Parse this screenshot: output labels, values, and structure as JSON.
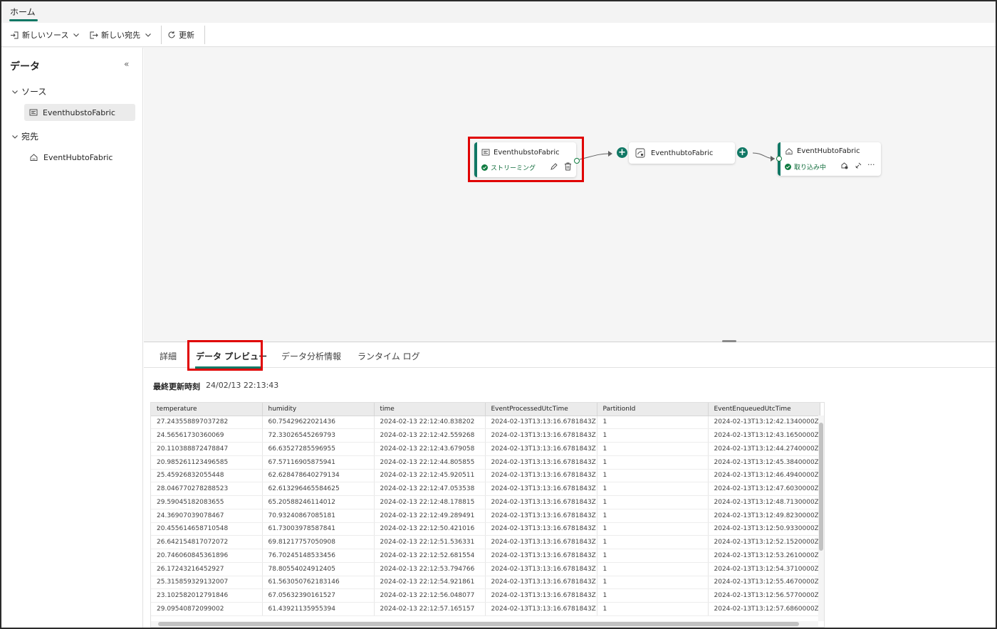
{
  "ribbon": {
    "home_tab": "ホーム"
  },
  "toolbar": {
    "new_source": "新しいソース",
    "new_destination": "新しい宛先",
    "refresh": "更新"
  },
  "sidebar": {
    "title": "データ",
    "groups": [
      {
        "label": "ソース",
        "items": [
          "EventhubstoFabric"
        ]
      },
      {
        "label": "宛先",
        "items": [
          "EventHubtoFabric"
        ]
      }
    ]
  },
  "canvas": {
    "source_node": {
      "title": "EventhubstoFabric",
      "status": "ストリーミング"
    },
    "stream_node": {
      "title": "EventhubtoFabric"
    },
    "dest_node": {
      "title": "EventHubtoFabric",
      "status": "取り込み中"
    }
  },
  "bottom_tabs": [
    "詳細",
    "データ プレビュー",
    "データ分析情報",
    "ランタイム ログ"
  ],
  "active_tab": "データ プレビュー",
  "last_updated": {
    "label": "最終更新時刻",
    "value": "24/02/13 22:13:43"
  },
  "table": {
    "columns": [
      "temperature",
      "humidity",
      "time",
      "EventProcessedUtcTime",
      "PartitionId",
      "EventEnqueuedUtcTime"
    ],
    "rows": [
      [
        "27.243558897037282",
        "60.75429622021436",
        "2024-02-13 22:12:40.838202",
        "2024-02-13T13:13:16.6781843Z",
        "1",
        "2024-02-13T13:12:42.1340000Z"
      ],
      [
        "24.56561730360069",
        "72.33026545269793",
        "2024-02-13 22:12:42.559268",
        "2024-02-13T13:13:16.6781843Z",
        "1",
        "2024-02-13T13:12:43.1650000Z"
      ],
      [
        "20.110388872478847",
        "66.63527285596955",
        "2024-02-13 22:12:43.679058",
        "2024-02-13T13:13:16.6781843Z",
        "1",
        "2024-02-13T13:12:44.2740000Z"
      ],
      [
        "20.985261123496585",
        "67.57116905875941",
        "2024-02-13 22:12:44.805855",
        "2024-02-13T13:13:16.6781843Z",
        "1",
        "2024-02-13T13:12:45.3840000Z"
      ],
      [
        "25.45926832055448",
        "62.628478640279134",
        "2024-02-13 22:12:45.920511",
        "2024-02-13T13:13:16.6781843Z",
        "1",
        "2024-02-13T13:12:46.4940000Z"
      ],
      [
        "28.046770278288523",
        "62.613296465584625",
        "2024-02-13 22:12:47.053538",
        "2024-02-13T13:13:16.6781843Z",
        "1",
        "2024-02-13T13:12:47.6030000Z"
      ],
      [
        "29.59045182083655",
        "65.20588246114012",
        "2024-02-13 22:12:48.178815",
        "2024-02-13T13:13:16.6781843Z",
        "1",
        "2024-02-13T13:12:48.7130000Z"
      ],
      [
        "24.36907039078467",
        "70.93240867085181",
        "2024-02-13 22:12:49.289491",
        "2024-02-13T13:13:16.6781843Z",
        "1",
        "2024-02-13T13:12:49.8230000Z"
      ],
      [
        "20.455614658710548",
        "61.73003978587841",
        "2024-02-13 22:12:50.421016",
        "2024-02-13T13:13:16.6781843Z",
        "1",
        "2024-02-13T13:12:50.9330000Z"
      ],
      [
        "26.642154817072072",
        "69.81217757050908",
        "2024-02-13 22:12:51.536331",
        "2024-02-13T13:13:16.6781843Z",
        "1",
        "2024-02-13T13:12:52.1520000Z"
      ],
      [
        "20.746060845361896",
        "76.70245148533456",
        "2024-02-13 22:12:52.681554",
        "2024-02-13T13:13:16.6781843Z",
        "1",
        "2024-02-13T13:12:53.2610000Z"
      ],
      [
        "26.17243216452927",
        "78.80554024912405",
        "2024-02-13 22:12:53.794766",
        "2024-02-13T13:13:16.6781843Z",
        "1",
        "2024-02-13T13:12:54.3710000Z"
      ],
      [
        "25.315859329132007",
        "61.563050762183146",
        "2024-02-13 22:12:54.921861",
        "2024-02-13T13:13:16.6781843Z",
        "1",
        "2024-02-13T13:12:55.4670000Z"
      ],
      [
        "23.102582012791846",
        "67.05632390161527",
        "2024-02-13 22:12:56.048077",
        "2024-02-13T13:13:16.6781843Z",
        "1",
        "2024-02-13T13:12:56.5770000Z"
      ],
      [
        "29.09540872099002",
        "61.43921135955394",
        "2024-02-13 22:12:57.165157",
        "2024-02-13T13:13:16.6781843Z",
        "1",
        "2024-02-13T13:12:57.6860000Z"
      ]
    ]
  },
  "colors": {
    "accent": "#117865",
    "highlight": "#e00000",
    "status_ok": "#107c41"
  }
}
